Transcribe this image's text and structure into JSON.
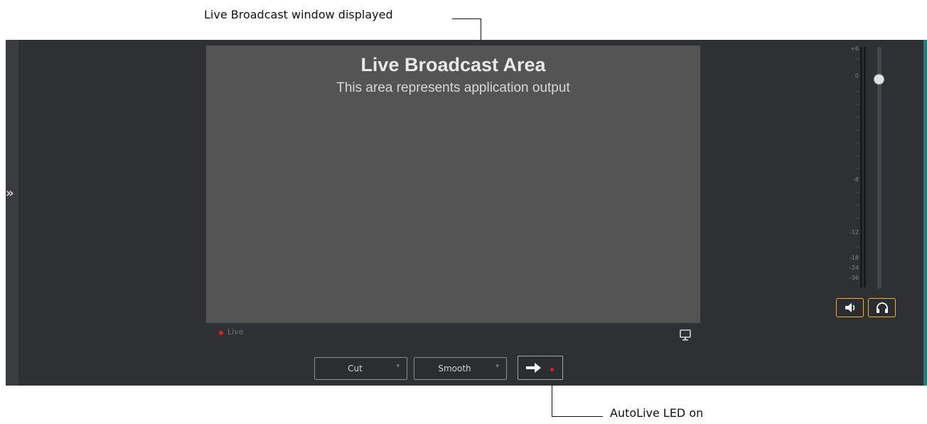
{
  "annotations": {
    "top": "Live Broadcast window displayed",
    "bottom": "AutoLive LED on"
  },
  "preview": {
    "title": "Live Broadcast Area",
    "subtitle": "This area represents application output"
  },
  "status": {
    "live_label": "Live"
  },
  "transition": {
    "type_value": "Cut",
    "speed_value": "Smooth"
  },
  "meter": {
    "ticks": [
      "+6",
      "-",
      "0",
      "-",
      "-",
      "-",
      "-",
      "-",
      "-",
      "-",
      "-",
      "-6",
      "-",
      "-",
      "-",
      "-12",
      "-",
      "-18",
      "-24",
      "-36"
    ],
    "level_fraction": 0.12
  },
  "icons": {
    "expand": "chevron-right-icon",
    "monitor": "monitor-icon",
    "take": "arrow-right-icon",
    "speaker": "speaker-icon",
    "headphones": "headphones-icon"
  },
  "colors": {
    "panel": "#2f3034",
    "preview": "#545454",
    "led": "#e0201c",
    "audio_accent": "#f1b22a"
  }
}
